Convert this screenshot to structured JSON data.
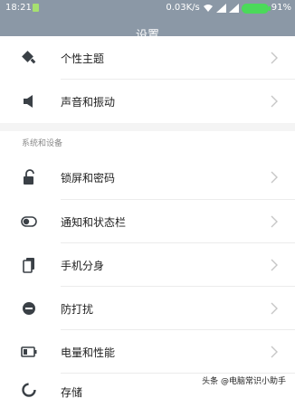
{
  "status_bar": {
    "time": "18:21",
    "network_speed": "0.03K/s",
    "battery_percent": "91%",
    "colors": {
      "battery": "#4bd95a",
      "sim": "#a6e070"
    }
  },
  "header": {
    "title": "设置"
  },
  "items_top": [
    {
      "label": "个性主题",
      "icon": "theme-brush-icon"
    },
    {
      "label": "声音和振动",
      "icon": "speaker-icon"
    }
  ],
  "section": {
    "header": "系统和设备"
  },
  "items": [
    {
      "label": "锁屏和密码",
      "icon": "lock-icon"
    },
    {
      "label": "通知和状态栏",
      "icon": "toggle-icon"
    },
    {
      "label": "手机分身",
      "icon": "phone-clone-icon"
    },
    {
      "label": "防打扰",
      "icon": "do-not-disturb-icon"
    },
    {
      "label": "电量和性能",
      "icon": "battery-icon"
    },
    {
      "label": "存储",
      "icon": "storage-icon"
    }
  ],
  "watermark": {
    "text": "头条 @电脑常识小助手"
  },
  "colors": {
    "header_bg": "#8b98a6",
    "icon": "#3a4046",
    "chevron": "#c6c6c6"
  }
}
